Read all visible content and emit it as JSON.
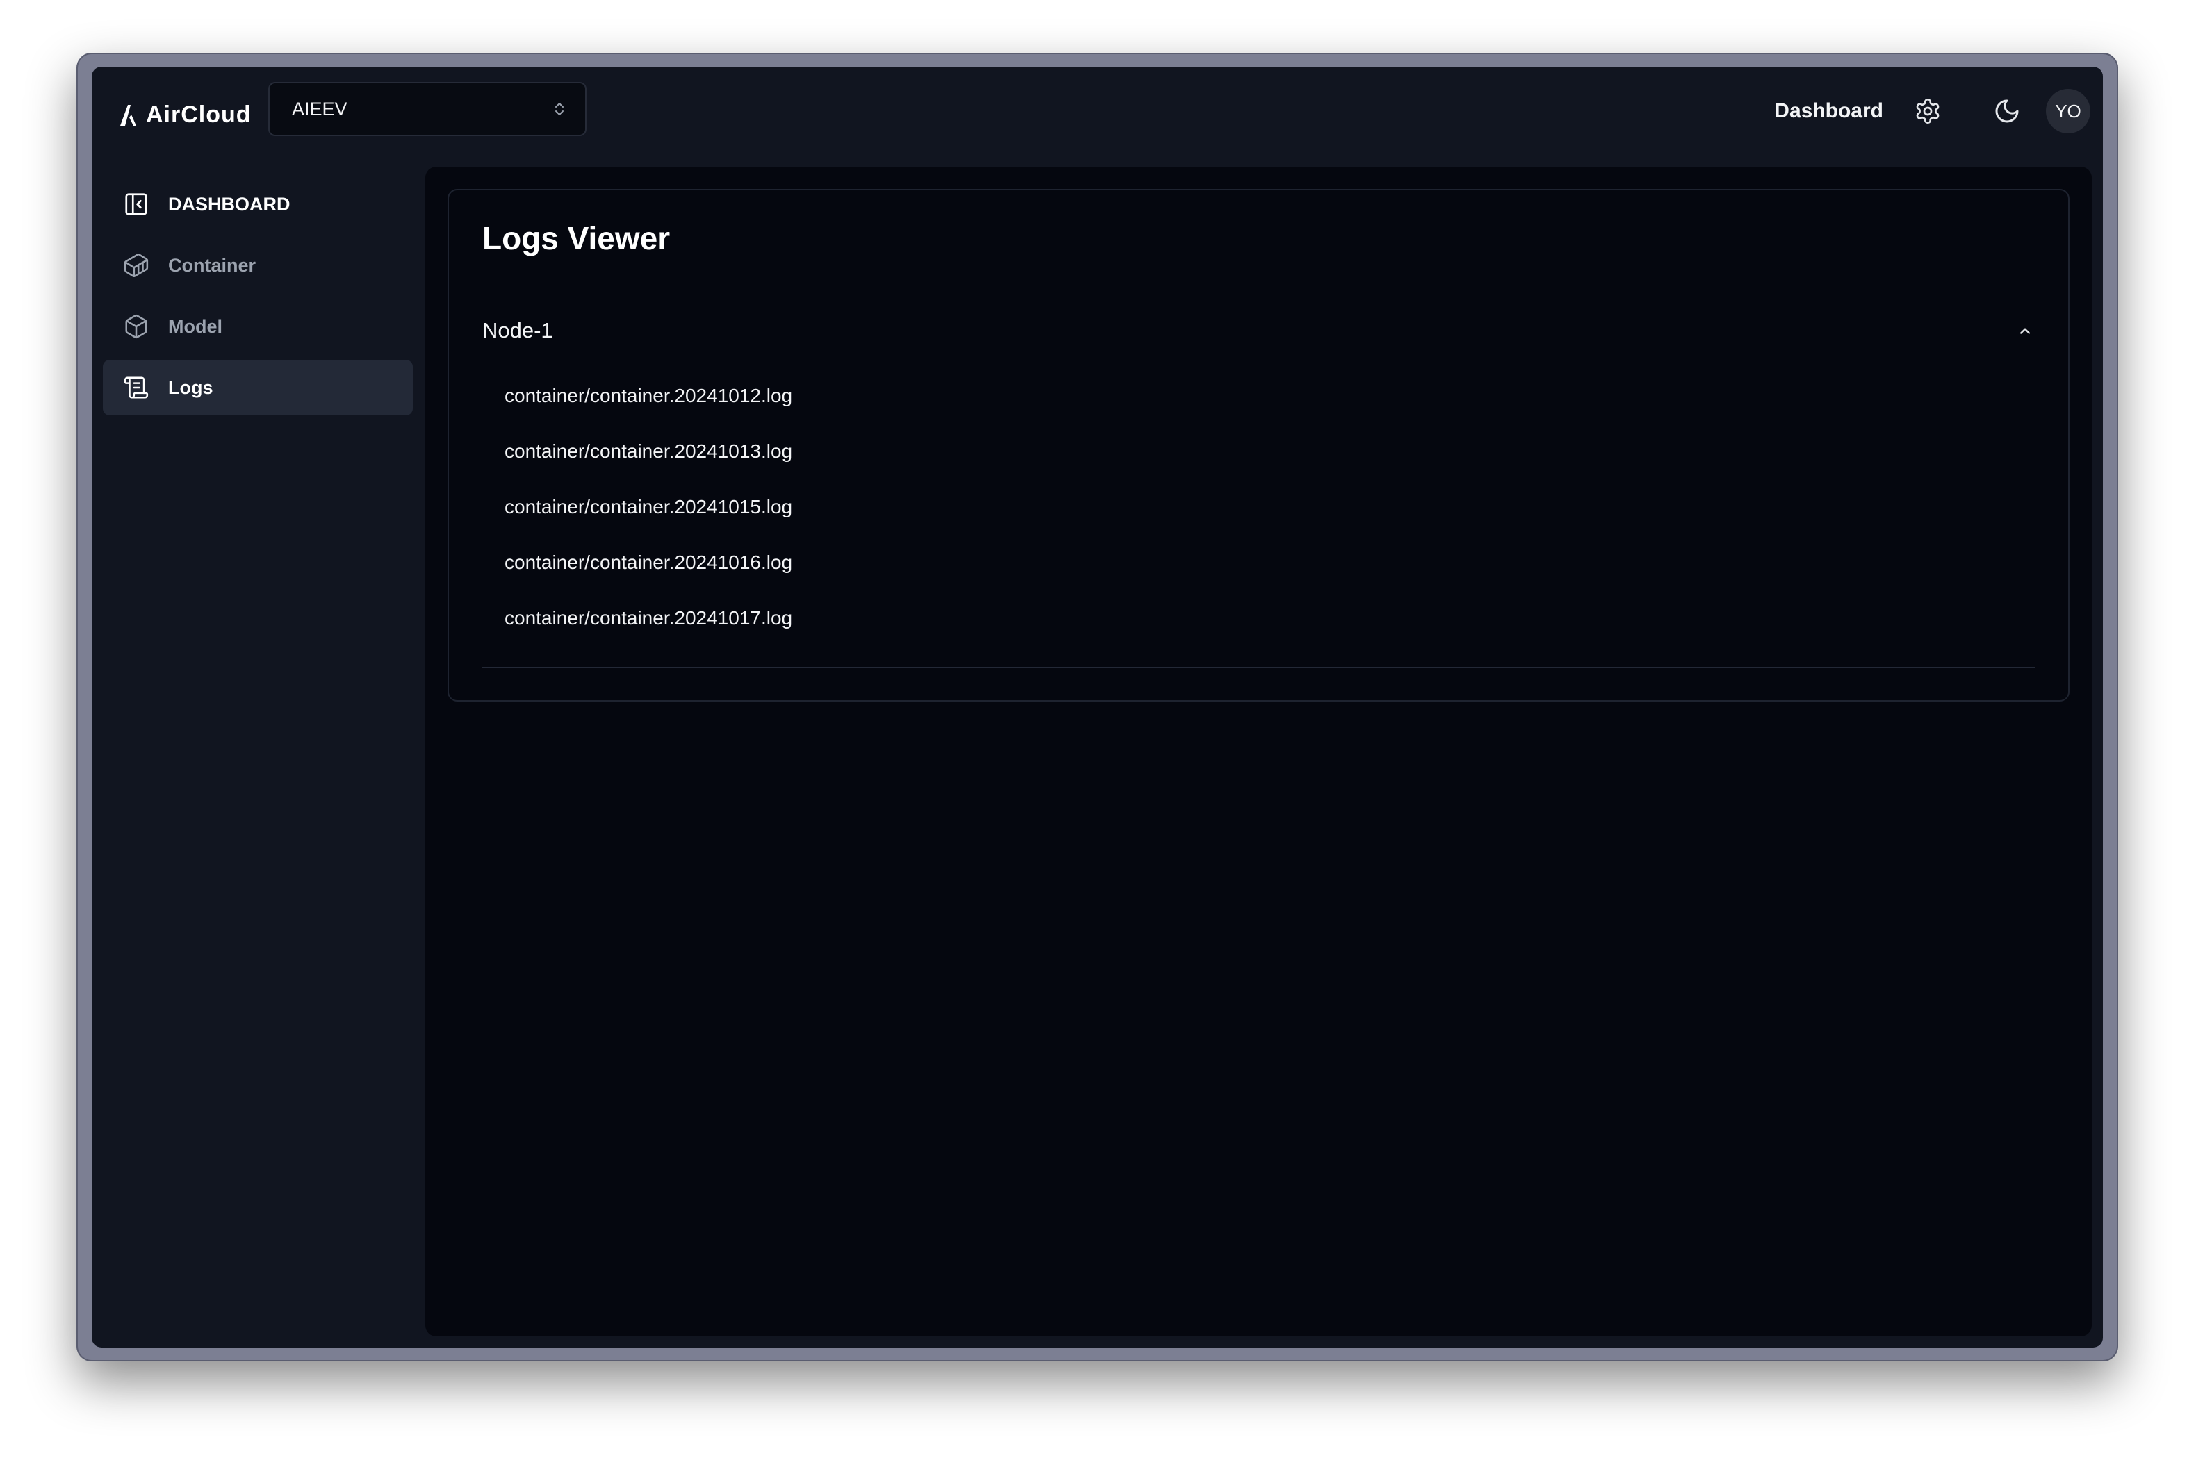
{
  "header": {
    "brand": "AirCloud",
    "org_select": {
      "value": "AIEEV"
    },
    "nav_link": "Dashboard",
    "avatar_initials": "YO",
    "icons": [
      "logo-icon",
      "chevron-up-down-icon",
      "gear-icon",
      "moon-icon"
    ]
  },
  "sidebar": {
    "header_label": "DASHBOARD",
    "items": [
      {
        "label": "Container",
        "icon": "container-box-icon",
        "active": false
      },
      {
        "label": "Model",
        "icon": "cube-icon",
        "active": false
      },
      {
        "label": "Logs",
        "icon": "scroll-icon",
        "active": true
      }
    ]
  },
  "main": {
    "title": "Logs Viewer",
    "accordion": {
      "node_label": "Node-1",
      "expanded": true,
      "files": [
        "container/container.20241012.log",
        "container/container.20241013.log",
        "container/container.20241015.log",
        "container/container.20241016.log",
        "container/container.20241017.log"
      ]
    }
  },
  "colors": {
    "app_bg": "#111520",
    "main_bg": "#05070f",
    "active_item_bg": "#232937",
    "border": "#1e2330",
    "text_primary": "#f3f4f6",
    "text_muted": "#9ca3af"
  }
}
